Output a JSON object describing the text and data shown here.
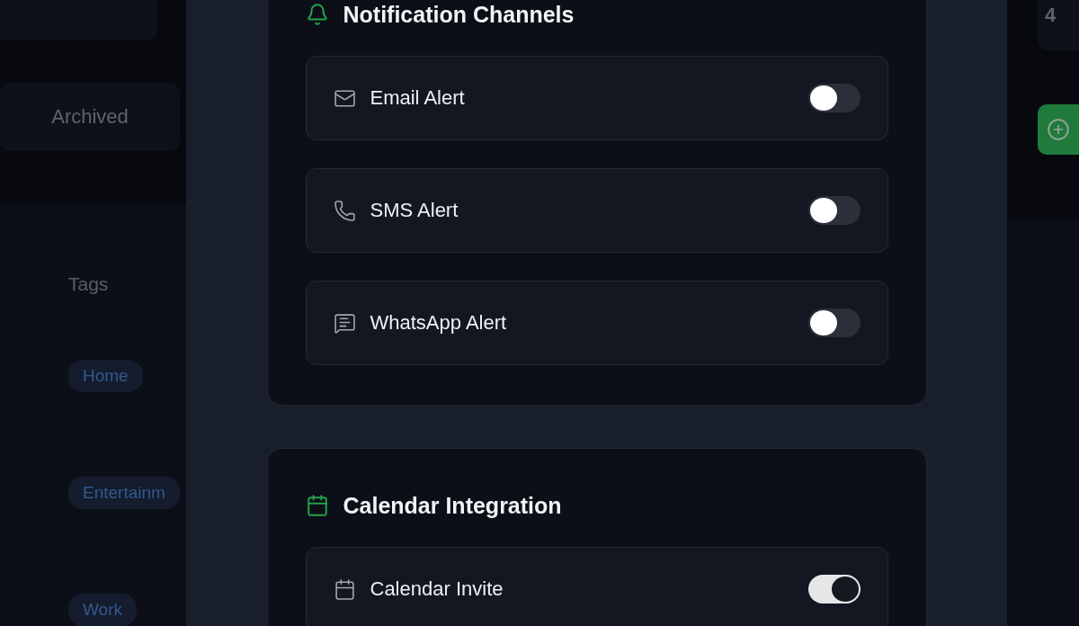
{
  "background": {
    "archived_button": "Archived",
    "tags_title": "Tags",
    "tags": [
      "Home",
      "Entertainm",
      "Work"
    ],
    "count": "4"
  },
  "sections": [
    {
      "kind": "bell",
      "title": "Notification Channels",
      "items": [
        {
          "kind": "email",
          "label": "Email Alert",
          "on": false
        },
        {
          "kind": "sms",
          "label": "SMS Alert",
          "on": false
        },
        {
          "kind": "chat",
          "label": "WhatsApp Alert",
          "on": false
        }
      ]
    },
    {
      "kind": "calendar",
      "title": "Calendar Integration",
      "items": [
        {
          "kind": "calendar",
          "label": "Calendar Invite",
          "on": true
        }
      ]
    }
  ]
}
